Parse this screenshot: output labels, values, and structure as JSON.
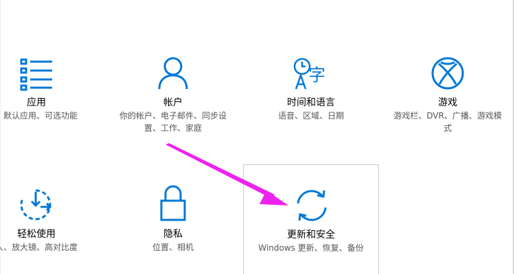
{
  "accent_color": "#0078d7",
  "annotation_color": "#ee22ee",
  "tiles": [
    {
      "id": "apps",
      "title": "应用",
      "desc": "、默认应用、可选功能",
      "icon": "list-icon"
    },
    {
      "id": "accounts",
      "title": "帐户",
      "desc": "你的帐户、电子邮件、同步设置、工作、家庭",
      "icon": "person-icon"
    },
    {
      "id": "time-language",
      "title": "时间和语言",
      "desc": "语音、区域、日期",
      "icon": "time-language-icon",
      "icon_glyph": "字"
    },
    {
      "id": "gaming",
      "title": "游戏",
      "desc": "游戏栏、DVR、广播、游戏模式",
      "icon": "xbox-icon"
    },
    {
      "id": "ease-of-access",
      "title": "轻松使用",
      "desc": "人、放大镜、高对比度",
      "icon": "ease-of-access-icon"
    },
    {
      "id": "privacy",
      "title": "隐私",
      "desc": "位置、相机",
      "icon": "lock-icon"
    },
    {
      "id": "update-security",
      "title": "更新和安全",
      "desc": "Windows 更新、恢复、备份",
      "icon": "sync-icon"
    }
  ]
}
